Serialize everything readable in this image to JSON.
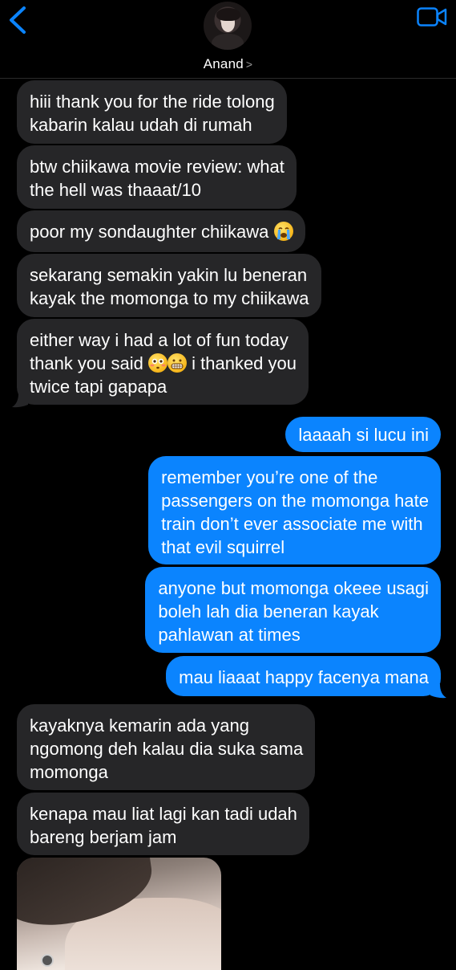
{
  "header": {
    "contact_name": "Anand",
    "back_icon": "chevron-left-icon",
    "video_icon": "video-camera-icon",
    "accent_color": "#0b84fe"
  },
  "messages": [
    {
      "direction": "received",
      "text": "hiii thank you for the ride tolong\nkabarin kalau udah di rumah"
    },
    {
      "direction": "received",
      "text": "btw chiikawa movie review: what\nthe hell was thaaat/10"
    },
    {
      "direction": "received",
      "text": "poor my sondaughter chiikawa",
      "emoji": "loudly-crying-face"
    },
    {
      "direction": "received",
      "text": "sekarang semakin yakin lu beneran\nkayak the momonga to my chiikawa"
    },
    {
      "direction": "received",
      "line1": "either way i had a lot of fun today",
      "line2a": "thank you said",
      "line2b": "i thanked you",
      "line3": "twice tapi gapapa",
      "emojis": [
        "flushed-face",
        "grimacing-face"
      ]
    },
    {
      "direction": "sent",
      "text": "laaaah si lucu ini"
    },
    {
      "direction": "sent",
      "text": "remember you’re one of the\npassengers on the momonga hate\ntrain don’t ever associate me with\nthat evil squirrel"
    },
    {
      "direction": "sent",
      "text": "anyone but momonga okeee usagi\nboleh lah dia beneran kayak\npahlawan at times"
    },
    {
      "direction": "sent",
      "text": "mau liaaat happy facenya mana"
    },
    {
      "direction": "received",
      "text": "kayaknya kemarin ada yang\nngomong deh kalau dia suka sama\nmomonga"
    },
    {
      "direction": "received",
      "text": "kenapa mau liat lagi kan tadi udah\nbareng berjam jam"
    }
  ],
  "colors": {
    "received_bubble": "#262628",
    "sent_bubble": "#0b84fe",
    "background": "#000000"
  }
}
